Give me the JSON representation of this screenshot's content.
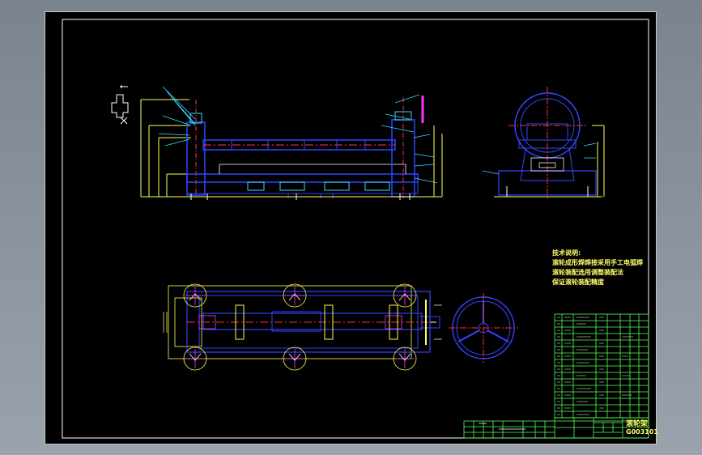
{
  "tech_notes": {
    "heading": "技术说明:",
    "lines": [
      "滚轮成形焊焊接采用手工电弧焊",
      "滚轮装配选用调整装配法",
      "保证滚轮装配精度"
    ]
  },
  "title_block": {
    "drawing_name": "滚轮架",
    "drawing_number": "G003101"
  },
  "colors": {
    "outline": "#ffff55",
    "body": "#3344ff",
    "dimension": "#33ddff",
    "center": "#ff3333",
    "highlight": "#ff33ff",
    "paper_border": "#55ff55",
    "canvas": "#000000"
  }
}
